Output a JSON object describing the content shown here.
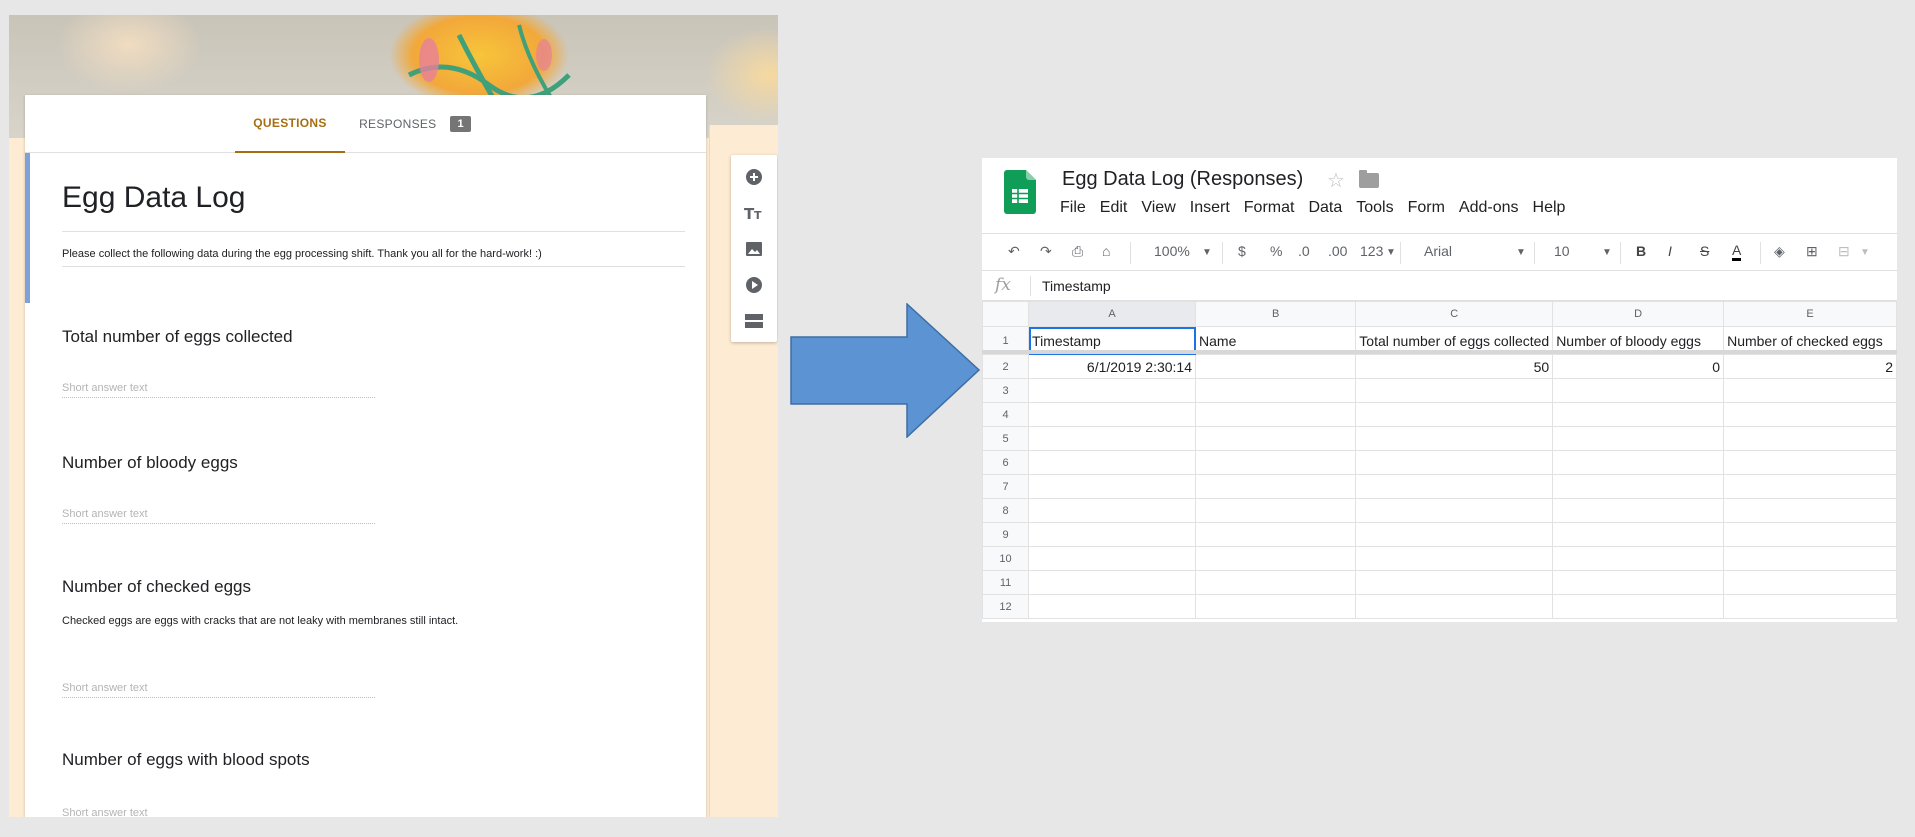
{
  "form": {
    "tabs": {
      "questions": "QUESTIONS",
      "responses": "RESPONSES",
      "responses_count": "1"
    },
    "title": "Egg Data Log",
    "description": "Please collect the following data during the egg processing shift. Thank you all for the hard-work! :)",
    "questions": [
      {
        "title": "Total number of eggs collected",
        "help": "",
        "answer_placeholder": "Short answer text"
      },
      {
        "title": "Number of bloody eggs",
        "help": "",
        "answer_placeholder": "Short answer text"
      },
      {
        "title": "Number of checked eggs",
        "help": "Checked eggs are eggs with cracks that are not leaky with membranes still intact.",
        "answer_placeholder": "Short answer text"
      },
      {
        "title": "Number of eggs with blood spots",
        "help": "",
        "answer_placeholder": "Short answer text"
      }
    ],
    "toolbar_icons": [
      "add-question-icon",
      "add-title-icon",
      "add-image-icon",
      "add-video-icon",
      "add-section-icon"
    ]
  },
  "sheets": {
    "title": "Egg Data Log (Responses)",
    "menu": [
      "File",
      "Edit",
      "View",
      "Insert",
      "Format",
      "Data",
      "Tools",
      "Form",
      "Add-ons",
      "Help"
    ],
    "toolbar": {
      "zoom": "100%",
      "currency": "$",
      "percent": "%",
      "dec_decrease": ".0",
      "dec_increase": ".00",
      "more_formats": "123",
      "font": "Arial",
      "font_size": "10",
      "bold": "B",
      "italic": "I",
      "strike": "S",
      "text_color": "A"
    },
    "formula_bar": {
      "fx": "fx",
      "value": "Timestamp"
    },
    "columns": [
      "A",
      "B",
      "C",
      "D",
      "E"
    ],
    "header_row": [
      "Timestamp",
      "Name",
      "Total number of eggs collected",
      "Number of bloody eggs",
      "Number of checked eggs"
    ],
    "data_rows": [
      [
        "6/1/2019 2:30:14",
        "",
        "50",
        "0",
        "2"
      ]
    ],
    "row_numbers": [
      "1",
      "2",
      "3",
      "4",
      "5",
      "6",
      "7",
      "8",
      "9",
      "10",
      "11",
      "12"
    ]
  },
  "colors": {
    "form_accent": "#a76d13",
    "sheets_green": "#0f9d58",
    "arrow": "#5b93d3",
    "selection": "#1a73e8"
  }
}
